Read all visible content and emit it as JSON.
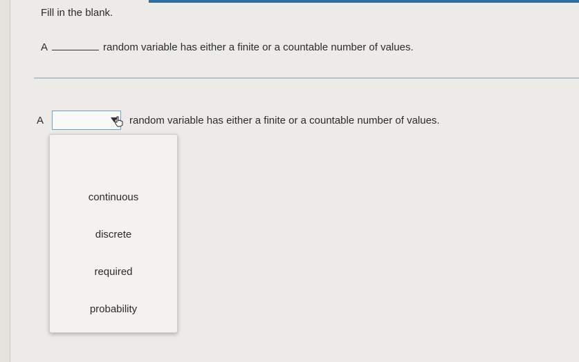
{
  "question": {
    "instruction": "Fill in the blank.",
    "prefix": "A",
    "suffix": "random variable has either a finite or a countable number of values."
  },
  "answer": {
    "prefix": "A",
    "selected": "",
    "suffix": "random variable has either a finite or a countable number of values."
  },
  "dropdown": {
    "options": [
      "continuous",
      "discrete",
      "required",
      "probability"
    ]
  },
  "colors": {
    "accent": "#2f6f9f",
    "dropdown_border": "#6f9fc4",
    "background": "#ecebe7"
  },
  "icons": {
    "dropdown_arrow": "chevron-down-icon",
    "cursor": "hand-cursor-icon"
  }
}
